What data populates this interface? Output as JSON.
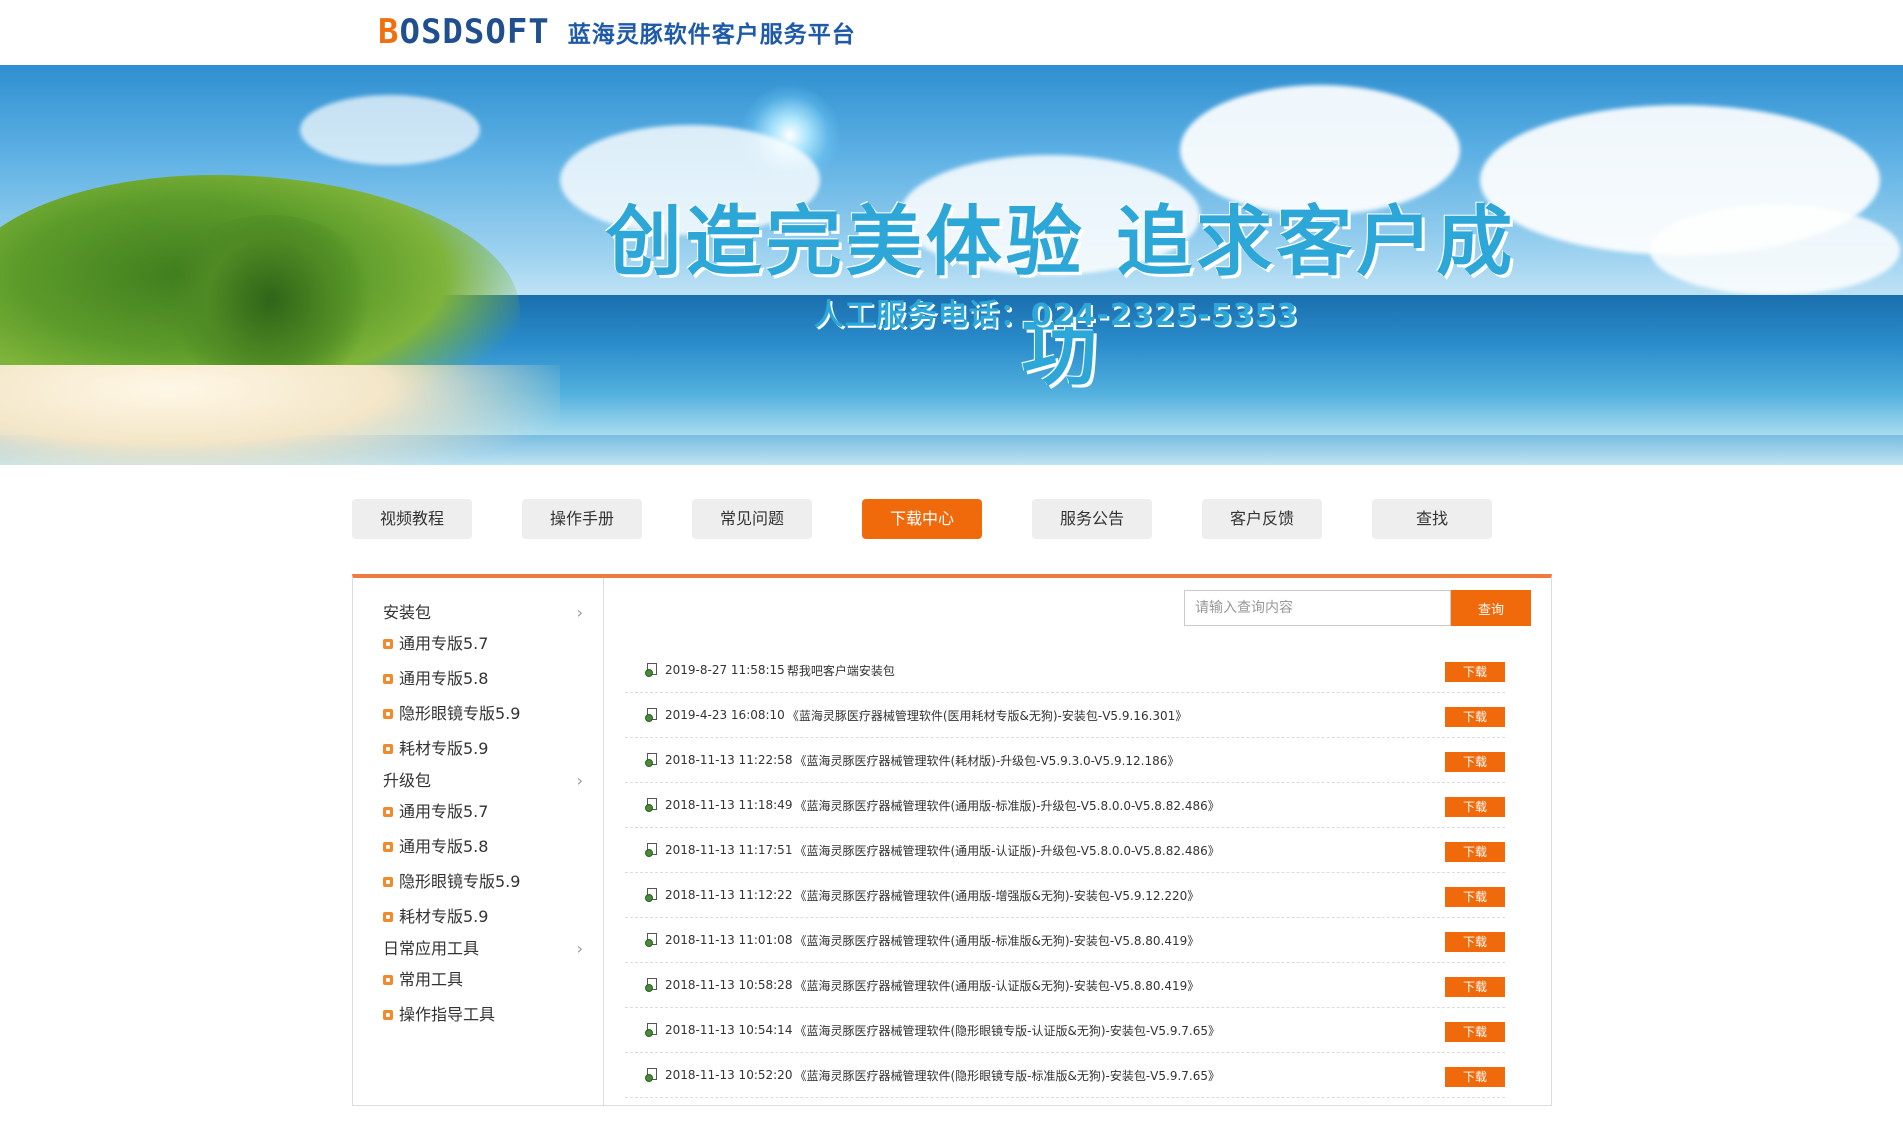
{
  "header": {
    "logo_text": "BOSDSOFT",
    "logo_first": "B",
    "logo_rest": "OSDSOFT",
    "title": "蓝海灵豚软件客户服务平台"
  },
  "banner": {
    "slogan": "创造完美体验 追求客户成功",
    "phone": "人工服务电话：024-2325-5353"
  },
  "nav": {
    "tabs": [
      {
        "label": "视频教程"
      },
      {
        "label": "操作手册"
      },
      {
        "label": "常见问题"
      },
      {
        "label": "下载中心",
        "active": true
      },
      {
        "label": "服务公告"
      },
      {
        "label": "客户反馈"
      },
      {
        "label": "查找"
      }
    ]
  },
  "sidebar": {
    "categories": [
      {
        "label": "安装包",
        "items": [
          "通用专版5.7",
          "通用专版5.8",
          "隐形眼镜专版5.9",
          "耗材专版5.9"
        ]
      },
      {
        "label": "升级包",
        "items": [
          "通用专版5.7",
          "通用专版5.8",
          "隐形眼镜专版5.9",
          "耗材专版5.9"
        ]
      },
      {
        "label": "日常应用工具",
        "items": [
          "常用工具",
          "操作指导工具"
        ]
      }
    ]
  },
  "search": {
    "placeholder": "请输入查询内容",
    "button_label": "查询"
  },
  "files": {
    "download_label": "下载",
    "rows": [
      {
        "date": "2019-8-27 11:58:15",
        "name": "帮我吧客户端安装包"
      },
      {
        "date": "2019-4-23 16:08:10",
        "name": "《蓝海灵豚医疗器械管理软件(医用耗材专版&无狗)-安装包-V5.9.16.301》"
      },
      {
        "date": "2018-11-13 11:22:58",
        "name": "《蓝海灵豚医疗器械管理软件(耗材版)-升级包-V5.9.3.0-V5.9.12.186》"
      },
      {
        "date": "2018-11-13 11:18:49",
        "name": "《蓝海灵豚医疗器械管理软件(通用版-标准版)-升级包-V5.8.0.0-V5.8.82.486》"
      },
      {
        "date": "2018-11-13 11:17:51",
        "name": "《蓝海灵豚医疗器械管理软件(通用版-认证版)-升级包-V5.8.0.0-V5.8.82.486》"
      },
      {
        "date": "2018-11-13 11:12:22",
        "name": "《蓝海灵豚医疗器械管理软件(通用版-增强版&无狗)-安装包-V5.9.12.220》"
      },
      {
        "date": "2018-11-13 11:01:08",
        "name": "《蓝海灵豚医疗器械管理软件(通用版-标准版&无狗)-安装包-V5.8.80.419》"
      },
      {
        "date": "2018-11-13 10:58:28",
        "name": "《蓝海灵豚医疗器械管理软件(通用版-认证版&无狗)-安装包-V5.8.80.419》"
      },
      {
        "date": "2018-11-13 10:54:14",
        "name": "《蓝海灵豚医疗器械管理软件(隐形眼镜专版-认证版&无狗)-安装包-V5.9.7.65》"
      },
      {
        "date": "2018-11-13 10:52:20",
        "name": "《蓝海灵豚医疗器械管理软件(隐形眼镜专版-标准版&无狗)-安装包-V5.9.7.65》"
      }
    ]
  },
  "colors": {
    "accent": "#f06a0c",
    "brand_blue": "#1e5aa8",
    "slogan_blue": "#2da6d8"
  }
}
